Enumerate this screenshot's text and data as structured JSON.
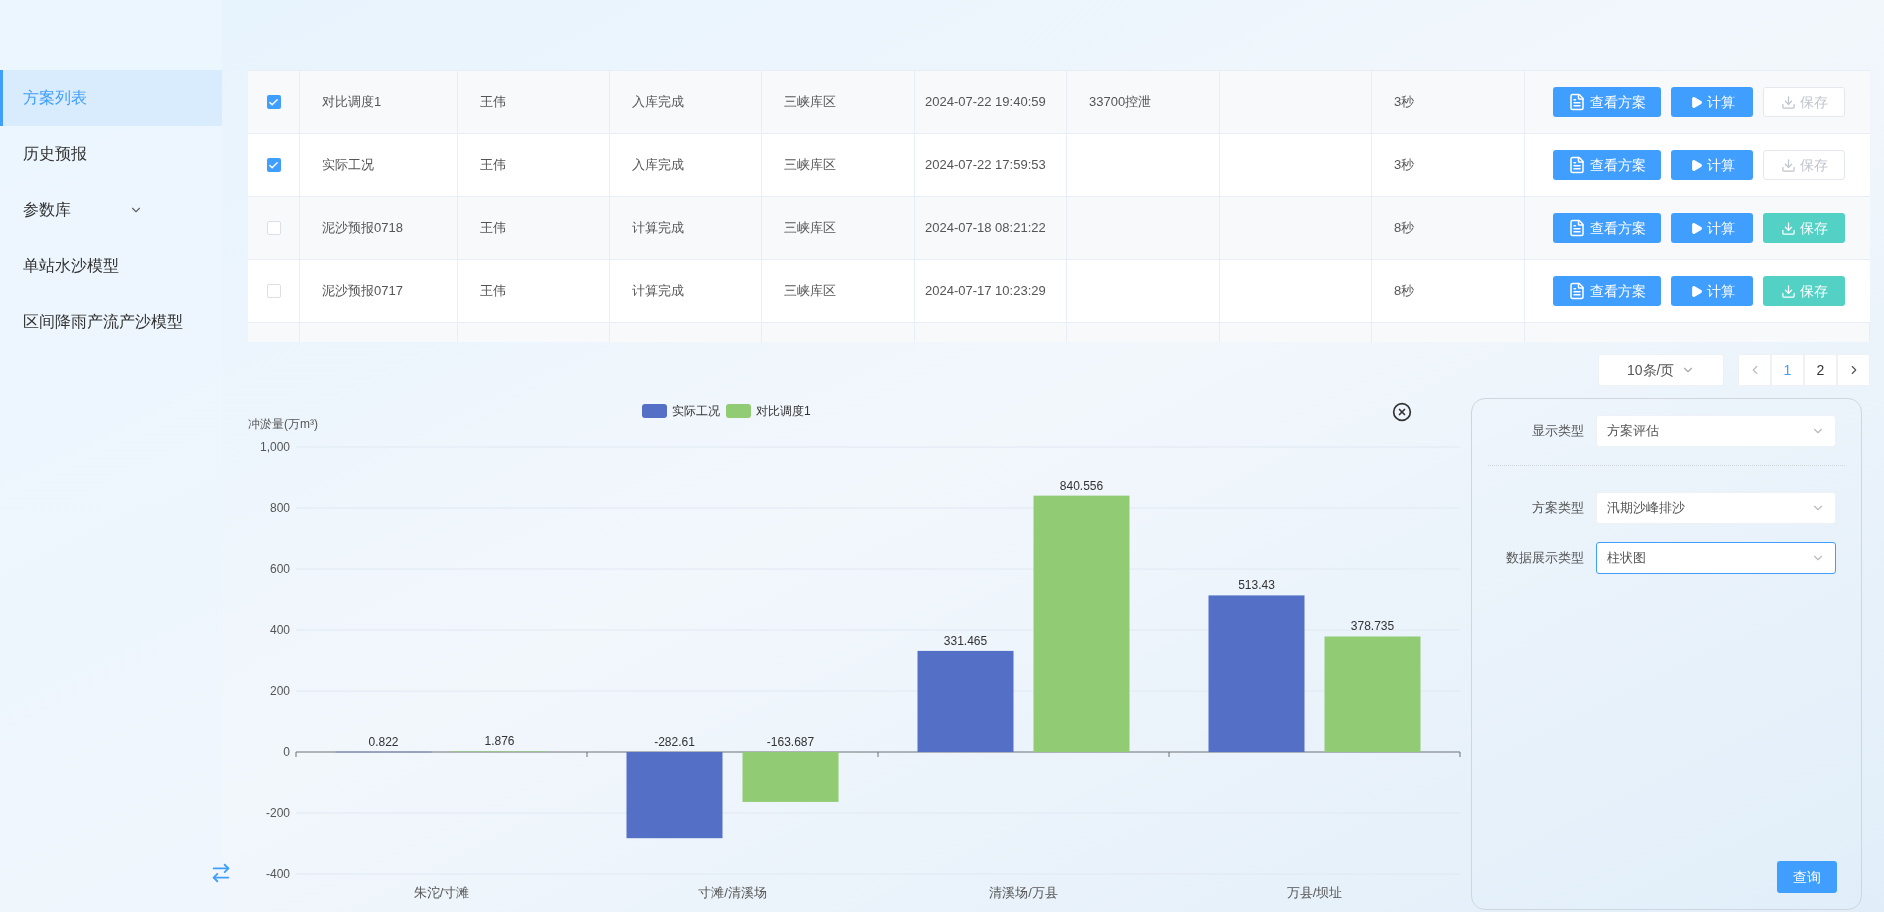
{
  "sidebar": {
    "items": [
      {
        "label": "方案列表",
        "selected": true
      },
      {
        "label": "历史预报",
        "selected": false
      },
      {
        "label": "参数库",
        "selected": false,
        "expanded": false
      },
      {
        "label": "单站水沙模型",
        "selected": false
      },
      {
        "label": "区间降雨产流产沙模型",
        "selected": false
      }
    ]
  },
  "table": {
    "rows": [
      {
        "checked": true,
        "name": "对比调度1",
        "user": "王伟",
        "status": "入库完成",
        "area": "三峡库区",
        "time": "2024-07-22 19:40:59",
        "column_7": "33700控泄",
        "duration": "3秒",
        "actions": [
          {
            "kind": "view",
            "label": "查看方案"
          },
          {
            "kind": "run",
            "label": "计算"
          },
          {
            "kind": "save",
            "label": "保存",
            "disabled": true
          }
        ]
      },
      {
        "checked": true,
        "name": "实际工况",
        "user": "王伟",
        "status": "入库完成",
        "area": "三峡库区",
        "time": "2024-07-22 17:59:53",
        "column_7": "",
        "duration": "3秒",
        "actions": [
          {
            "kind": "view",
            "label": "查看方案"
          },
          {
            "kind": "run",
            "label": "计算"
          },
          {
            "kind": "save",
            "label": "保存",
            "disabled": true
          }
        ]
      },
      {
        "checked": false,
        "name": "泥沙预报0718",
        "user": "王伟",
        "status": "计算完成",
        "area": "三峡库区",
        "time": "2024-07-18 08:21:22",
        "column_7": "",
        "duration": "8秒",
        "actions": [
          {
            "kind": "view",
            "label": "查看方案"
          },
          {
            "kind": "run",
            "label": "计算"
          },
          {
            "kind": "save",
            "label": "保存",
            "disabled": false
          }
        ]
      },
      {
        "checked": false,
        "name": "泥沙预报0717",
        "user": "王伟",
        "status": "计算完成",
        "area": "三峡库区",
        "time": "2024-07-17 10:23:29",
        "column_7": "",
        "duration": "8秒",
        "actions": [
          {
            "kind": "view",
            "label": "查看方案"
          },
          {
            "kind": "run",
            "label": "计算"
          },
          {
            "kind": "save",
            "label": "保存",
            "disabled": false
          }
        ]
      }
    ]
  },
  "pagination": {
    "page_size": "10条/页",
    "pages": [
      {
        "label": "1",
        "selected": true
      },
      {
        "label": "2",
        "selected": false
      }
    ]
  },
  "chart": {
    "chart_data": {
      "type": "bar",
      "ylabel": "冲淤量(万m³)",
      "categories": [
        "朱沱/寸滩",
        "寸滩/清溪场",
        "清溪场/万县",
        "万县/坝址"
      ],
      "series": [
        {
          "name": "实际工况",
          "color": "#5470c6",
          "values": [
            0.822,
            -282.61,
            331.465,
            513.43
          ]
        },
        {
          "name": "对比调度1",
          "color": "#91cc75",
          "values": [
            1.876,
            -163.687,
            840.556,
            378.735
          ]
        }
      ],
      "yticks": [
        {
          "value": -400,
          "label": "-400"
        },
        {
          "value": -200,
          "label": "-200"
        },
        {
          "value": 0,
          "label": "0"
        },
        {
          "value": 200,
          "label": "200"
        },
        {
          "value": 400,
          "label": "400"
        },
        {
          "value": 600,
          "label": "600"
        },
        {
          "value": 800,
          "label": "800"
        },
        {
          "value": 1000,
          "label": "1,000"
        }
      ],
      "ylim": [
        -400,
        1000
      ],
      "data_labels": true,
      "grid": true,
      "legend": "top"
    }
  },
  "filters": {
    "fields": [
      {
        "label": "显示类型",
        "value": "方案评估",
        "focused": false,
        "divider_after": true
      },
      {
        "label": "方案类型",
        "value": "汛期沙峰排沙",
        "focused": false,
        "divider_after": false
      },
      {
        "label": "数据展示类型",
        "value": "柱状图",
        "focused": true,
        "divider_after": false
      }
    ],
    "button": "查询"
  }
}
